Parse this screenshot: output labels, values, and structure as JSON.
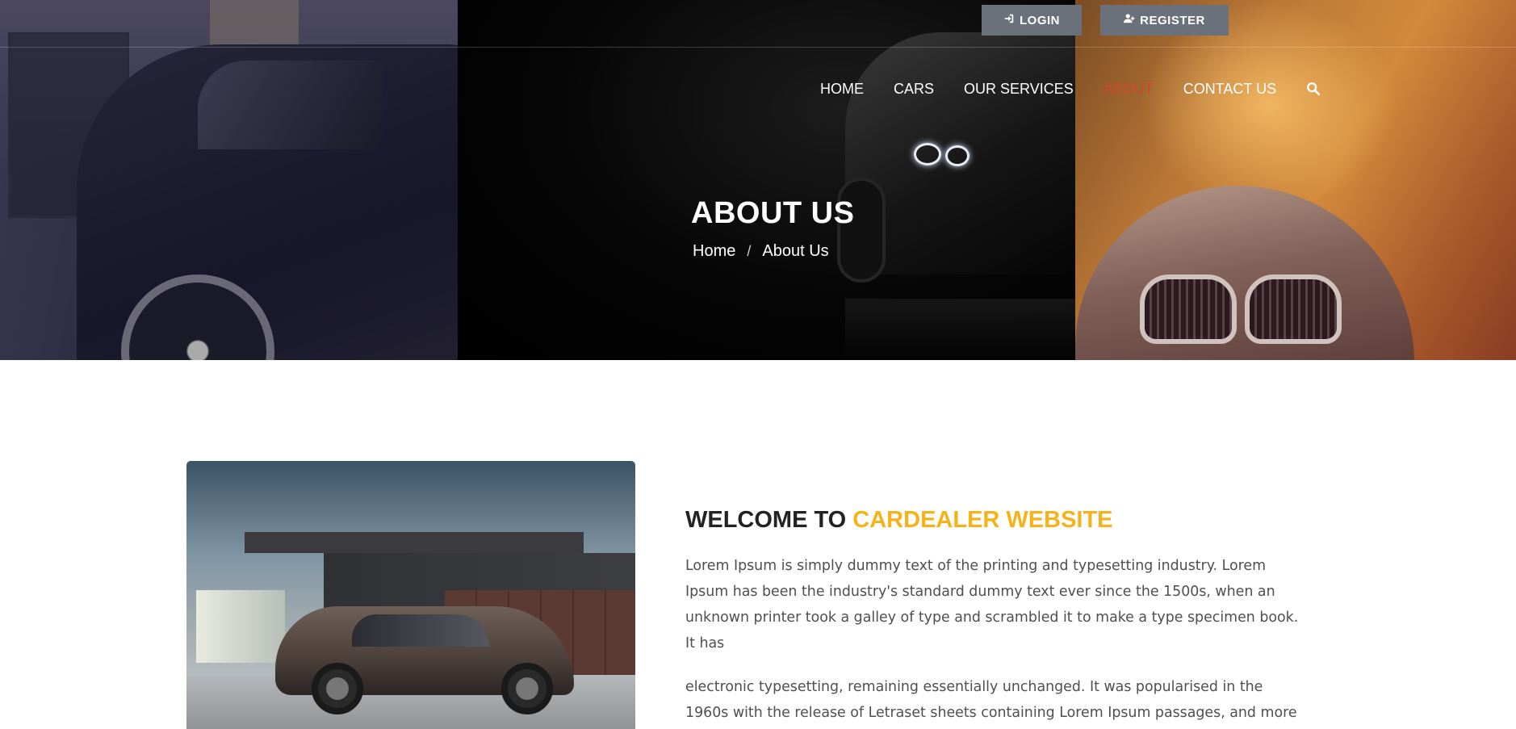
{
  "header": {
    "login_label": "LOGIN",
    "register_label": "REGISTER",
    "nav": [
      {
        "label": "HOME"
      },
      {
        "label": "CARS"
      },
      {
        "label": "OUR SERVICES"
      },
      {
        "label": "ABOUT",
        "active": true
      },
      {
        "label": "CONTACT US"
      }
    ],
    "search_icon": "search-icon",
    "active_color": "#c94a2c"
  },
  "hero": {
    "title": "ABOUT US",
    "breadcrumb": [
      "Home",
      "About Us"
    ],
    "separator": "/"
  },
  "about": {
    "heading_prefix": "WELCOME TO",
    "heading_accent": "CARDEALER WEBSITE",
    "accent_color": "#f6b319",
    "paragraph_1": "Lorem Ipsum is simply dummy text of the printing and typesetting industry. Lorem Ipsum has been the industry's standard dummy text ever since the 1500s, when an unknown printer took a galley of type and scrambled it to make a type specimen book. It has",
    "paragraph_2": "electronic typesetting, remaining essentially unchanged. It was popularised in the 1960s with the release of Letraset sheets containing Lorem Ipsum passages, and more"
  }
}
